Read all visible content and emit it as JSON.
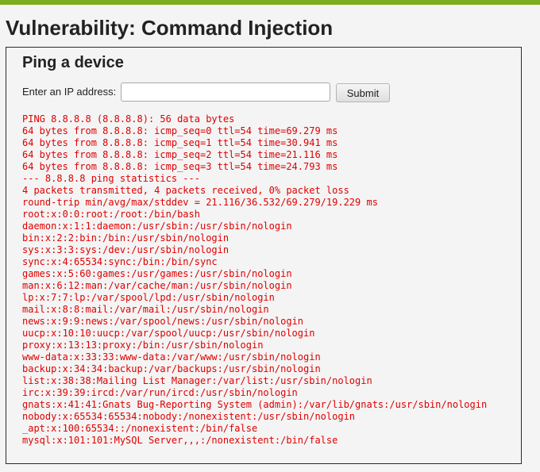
{
  "page": {
    "title": "Vulnerability: Command Injection"
  },
  "panel": {
    "title": "Ping a device",
    "ip_label": "Enter an IP address:",
    "ip_value": "",
    "ip_placeholder": "",
    "submit_label": "Submit"
  },
  "colors": {
    "accent_bar": "#7cad1d",
    "output_text": "#e00000"
  },
  "output_lines": [
    "PING 8.8.8.8 (8.8.8.8): 56 data bytes",
    "64 bytes from 8.8.8.8: icmp_seq=0 ttl=54 time=69.279 ms",
    "64 bytes from 8.8.8.8: icmp_seq=1 ttl=54 time=30.941 ms",
    "64 bytes from 8.8.8.8: icmp_seq=2 ttl=54 time=21.116 ms",
    "64 bytes from 8.8.8.8: icmp_seq=3 ttl=54 time=24.793 ms",
    "--- 8.8.8.8 ping statistics ---",
    "4 packets transmitted, 4 packets received, 0% packet loss",
    "round-trip min/avg/max/stddev = 21.116/36.532/69.279/19.229 ms",
    "root:x:0:0:root:/root:/bin/bash",
    "daemon:x:1:1:daemon:/usr/sbin:/usr/sbin/nologin",
    "bin:x:2:2:bin:/bin:/usr/sbin/nologin",
    "sys:x:3:3:sys:/dev:/usr/sbin/nologin",
    "sync:x:4:65534:sync:/bin:/bin/sync",
    "games:x:5:60:games:/usr/games:/usr/sbin/nologin",
    "man:x:6:12:man:/var/cache/man:/usr/sbin/nologin",
    "lp:x:7:7:lp:/var/spool/lpd:/usr/sbin/nologin",
    "mail:x:8:8:mail:/var/mail:/usr/sbin/nologin",
    "news:x:9:9:news:/var/spool/news:/usr/sbin/nologin",
    "uucp:x:10:10:uucp:/var/spool/uucp:/usr/sbin/nologin",
    "proxy:x:13:13:proxy:/bin:/usr/sbin/nologin",
    "www-data:x:33:33:www-data:/var/www:/usr/sbin/nologin",
    "backup:x:34:34:backup:/var/backups:/usr/sbin/nologin",
    "list:x:38:38:Mailing List Manager:/var/list:/usr/sbin/nologin",
    "irc:x:39:39:ircd:/var/run/ircd:/usr/sbin/nologin",
    "gnats:x:41:41:Gnats Bug-Reporting System (admin):/var/lib/gnats:/usr/sbin/nologin",
    "nobody:x:65534:65534:nobody:/nonexistent:/usr/sbin/nologin",
    "_apt:x:100:65534::/nonexistent:/bin/false",
    "mysql:x:101:101:MySQL Server,,,:/nonexistent:/bin/false"
  ]
}
